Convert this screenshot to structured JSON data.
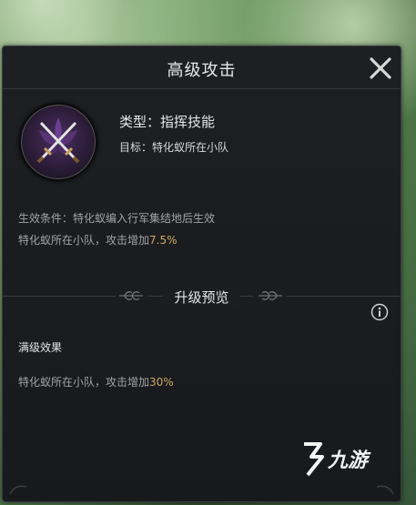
{
  "dialog": {
    "title": "高级攻击",
    "close_icon": "close-icon"
  },
  "skill": {
    "icon": "crossed-swords-emblem-icon",
    "type_text": "类型：指挥技能",
    "target_text": "目标：特化蚁所在小队",
    "condition_text": "生效条件：特化蚁编入行军集结地后生效",
    "effect_prefix": "特化蚁所在小队，攻击增加",
    "effect_value": "7.5%"
  },
  "upgrade": {
    "section_title": "升级预览",
    "info_icon": "info-icon",
    "max_label": "满级效果",
    "max_effect_prefix": "特化蚁所在小队，攻击增加",
    "max_effect_value": "30%"
  },
  "watermark": {
    "brand_text": "九游"
  },
  "colors": {
    "panel_bg": "#1b1d20",
    "highlight": "#d6a95a",
    "text_primary": "#e9e9e9",
    "text_secondary": "#a3a3a3"
  }
}
